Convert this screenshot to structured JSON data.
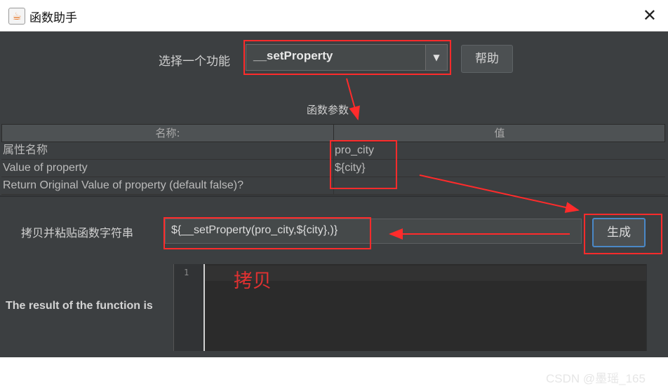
{
  "window": {
    "title": "函数助手",
    "icon": "java-coffee-icon",
    "close_glyph": "✕"
  },
  "function_selector": {
    "label": "选择一个功能",
    "selected": "__setProperty",
    "arrow": "▼",
    "help_button": "帮助"
  },
  "params": {
    "title": "函数参数",
    "columns": [
      "名称:",
      "值"
    ],
    "rows": [
      {
        "name": "属性名称",
        "value": "pro_city"
      },
      {
        "name": "Value of property",
        "value": "${city}"
      },
      {
        "name": "Return Original Value of property (default false)?",
        "value": ""
      }
    ]
  },
  "copy": {
    "label": "拷贝并粘贴函数字符串",
    "value": "${__setProperty(pro_city,${city},)}",
    "generate_button": "生成"
  },
  "result": {
    "label": "The result of the function is",
    "line_number": "1"
  },
  "annotations": {
    "copy_text": "拷贝",
    "watermark": "CSDN @墨瑶_165",
    "highlight_color": "#ff2b2b"
  }
}
